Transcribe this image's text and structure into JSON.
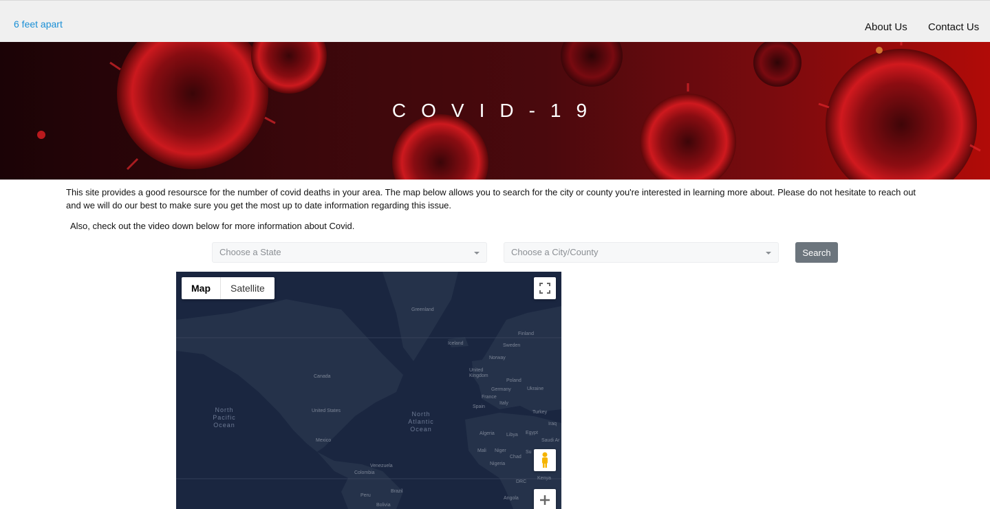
{
  "nav": {
    "brand": "6 feet apart",
    "about": "About Us",
    "contact": "Contact Us"
  },
  "hero": {
    "title": "COVID-19"
  },
  "content": {
    "intro": "This site provides a good resoursce for the number of covid deaths in your area. The map below allows you to search for the city or county you're interested in learning more about. Please do not hesitate to reach out and we will do our best to make sure you get the most up to date information regarding this issue.",
    "video_note": "Also, check out the video down below for more information about Covid."
  },
  "search": {
    "state_placeholder": "Choose a State",
    "city_placeholder": "Choose a City/County",
    "button_label": "Search"
  },
  "map": {
    "type_map": "Map",
    "type_satellite": "Satellite",
    "labels": {
      "greenland": "Greenland",
      "finland": "Finland",
      "iceland": "Iceland",
      "sweden": "Sweden",
      "norway": "Norway",
      "uk": "United Kingdom",
      "canada": "Canada",
      "poland": "Poland",
      "germany": "Germany",
      "ukraine": "Ukraine",
      "france": "France",
      "spain": "Spain",
      "italy": "Italy",
      "turkey": "Turkey",
      "iraq": "Iraq",
      "us": "United States",
      "algeria": "Algeria",
      "libya": "Libya",
      "egypt": "Egypt",
      "saudi": "Saudi Ar",
      "mexico": "Mexico",
      "mali": "Mali",
      "niger": "Niger",
      "chad": "Chad",
      "sudan": "Su",
      "nigeria": "Nigeria",
      "venezuela": "Venezuela",
      "colombia": "Colombia",
      "drc": "DRC",
      "kenya": "Kenya",
      "peru": "Peru",
      "brazil": "Brazil",
      "angola": "Angola",
      "bolivia": "Bolivia"
    },
    "oceans": {
      "north_pacific": "North Pacific Ocean",
      "north_atlantic": "North Atlantic Ocean"
    }
  },
  "colors": {
    "brand": "#1a8fd6",
    "map_ocean": "#1a2640",
    "map_land": "#25324a",
    "button": "#6c757d"
  }
}
